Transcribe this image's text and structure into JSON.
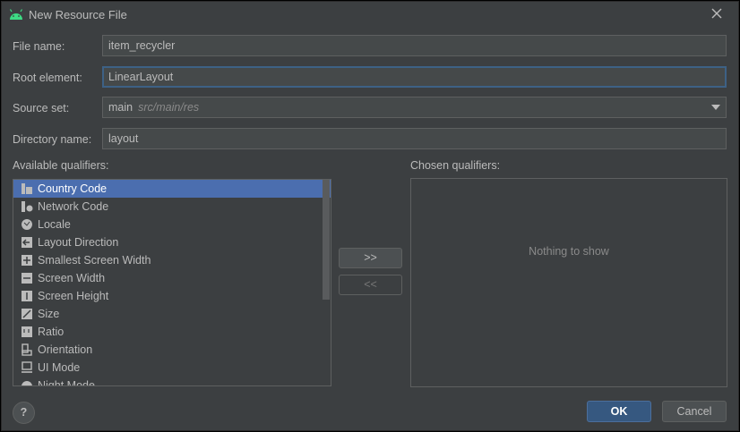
{
  "dialog": {
    "title": "New Resource File",
    "title_icon": "android-icon"
  },
  "form": {
    "file_name": {
      "label": "File name:",
      "value": "item_recycler"
    },
    "root_element": {
      "label": "Root element:",
      "value": "LinearLayout"
    },
    "source_set": {
      "label": "Source set:",
      "value": "main",
      "hint": "src/main/res"
    },
    "directory_name": {
      "label": "Directory name:",
      "value": "layout"
    }
  },
  "qualifiers": {
    "available_label": "Available qualifiers:",
    "chosen_label": "Chosen qualifiers:",
    "items": [
      {
        "label": "Country Code",
        "icon": "country-code-icon",
        "selected": true
      },
      {
        "label": "Network Code",
        "icon": "network-code-icon"
      },
      {
        "label": "Locale",
        "icon": "globe-icon"
      },
      {
        "label": "Layout Direction",
        "icon": "layout-direction-icon"
      },
      {
        "label": "Smallest Screen Width",
        "icon": "smallest-width-icon"
      },
      {
        "label": "Screen Width",
        "icon": "screen-width-icon"
      },
      {
        "label": "Screen Height",
        "icon": "screen-height-icon"
      },
      {
        "label": "Size",
        "icon": "size-icon"
      },
      {
        "label": "Ratio",
        "icon": "ratio-icon"
      },
      {
        "label": "Orientation",
        "icon": "orientation-icon"
      },
      {
        "label": "UI Mode",
        "icon": "ui-mode-icon"
      },
      {
        "label": "Night Mode",
        "icon": "night-mode-icon"
      }
    ],
    "add_label": ">>",
    "remove_label": "<<",
    "empty_text": "Nothing to show"
  },
  "footer": {
    "help_label": "?",
    "ok_label": "OK",
    "cancel_label": "Cancel"
  },
  "colors": {
    "background": "#3c3f41",
    "selection": "#4b6eaf",
    "focus": "#3d6185",
    "primary_button": "#365880"
  }
}
